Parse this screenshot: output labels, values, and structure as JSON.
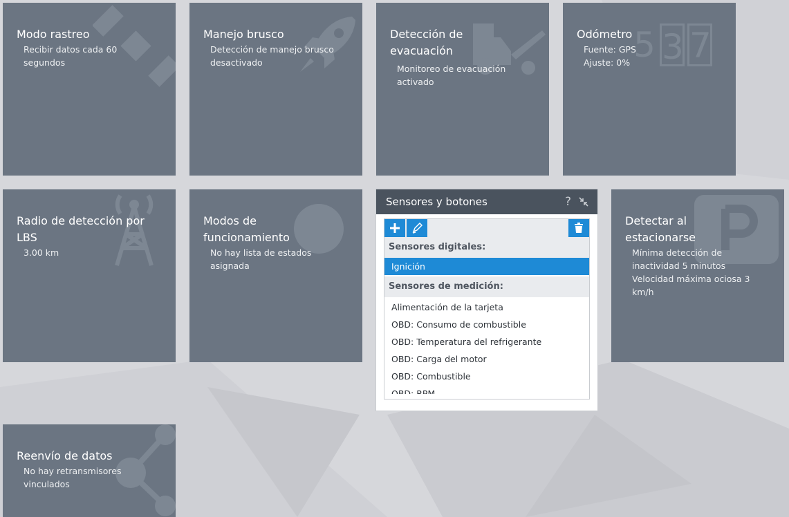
{
  "tiles": {
    "tracking": {
      "title": "Modo rastreo",
      "desc": "Recibir datos cada 60\nsegundos"
    },
    "harsh": {
      "title": "Manejo brusco",
      "desc": "Detección de manejo brusco\ndesactivado"
    },
    "towing": {
      "title": "Detección de\nevacuación",
      "desc": "Monitoreo de evacuación\nactivado"
    },
    "odometer": {
      "title": "Odómetro",
      "desc": "Fuente: GPS\nAjuste: 0%",
      "digits": [
        "5",
        "3",
        "7"
      ]
    },
    "lbs": {
      "title": "Radio de detección por\nLBS",
      "desc": "3.00 km"
    },
    "modes": {
      "title": "Modos de\nfuncionamiento",
      "desc": "No hay lista de estados\nasignada"
    },
    "parking": {
      "title": "Detectar al\nestacionarse",
      "desc": "Mínima detección de\ninactividad 5 minutos\nVelocidad máxima ociosa 3\nkm/h"
    },
    "forwarding": {
      "title": "Reenvío de datos",
      "desc": "No hay retransmisores\nvinculados"
    }
  },
  "panel": {
    "title": "Sensores y botones",
    "help": "?",
    "digital_label": "Sensores digitales:",
    "digital_items": [
      "Ignición"
    ],
    "measure_label": "Sensores de medición:",
    "measure_items": [
      "Alimentación de la tarjeta",
      "OBD: Consumo de combustible",
      "OBD: Temperatura del refrigerante",
      "OBD: Carga del motor",
      "OBD: Combustible",
      "OBD: RPM"
    ]
  },
  "colors": {
    "tile": "#6b7582",
    "accent": "#1e8ad6",
    "header": "#4a535e",
    "background": "#d6d7db"
  }
}
